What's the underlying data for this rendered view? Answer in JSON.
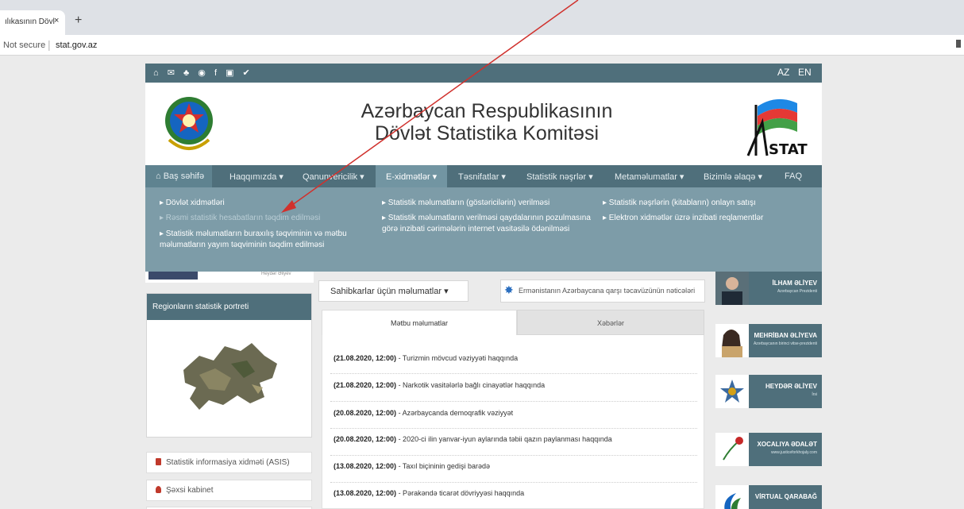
{
  "browser": {
    "tab_title": "ılıkasının Dövl",
    "tab_close": "×",
    "new_tab": "+",
    "security": "Not secure",
    "url": "stat.gov.az"
  },
  "topbar": {
    "social_icons": [
      "home-icon",
      "mail-icon",
      "sitemap-icon",
      "eye-icon",
      "facebook-icon",
      "youtube-icon",
      "twitter-icon"
    ],
    "social_glyphs": [
      "⌂",
      "✉",
      "♣",
      "◉",
      "f",
      "▣",
      "✔"
    ],
    "lang_az": "AZ",
    "lang_en": "EN"
  },
  "header": {
    "title_line1": "Azərbaycan Respublikasının",
    "title_line2": "Dövlət Statistika Komitəsi",
    "statlogo_text": "STAT"
  },
  "nav": {
    "items": [
      {
        "label": "⌂ Baş səhifə"
      },
      {
        "label": "Haqqımızda ▾"
      },
      {
        "label": "Qanunvericilik ▾"
      },
      {
        "label": "E-xidmətlər ▾"
      },
      {
        "label": "Təsnifatlar ▾"
      },
      {
        "label": "Statistik nəşrlər ▾"
      },
      {
        "label": "Metaməlumatlar ▾"
      },
      {
        "label": "Bizimlə əlaqə ▾"
      },
      {
        "label": "FAQ"
      }
    ]
  },
  "dropdown": {
    "col1": [
      "▸ Dövlət xidmətləri",
      "▸ Rəsmi statistik hesabatların təqdim edilməsi",
      "▸ Statistik məlumatların buraxılış təqviminin və mətbu məlumatların yayım təqviminin təqdim edilməsi"
    ],
    "col2": [
      "▸ Statistik məlumatların (göstəricilərin) verilməsi",
      "▸ Statistik məlumatların verilməsi qaydalarının pozulmasına görə inzibati cərimələrin internet vasitəsilə ödənilməsi"
    ],
    "col3": [
      "▸ Statistik nəşrlərin (kitabların) onlayn satışı",
      "▸ Elektron xidmətlər üzrə inzibati reqlamentlər"
    ]
  },
  "left": {
    "heydar_caption": "Heydər Əliyev",
    "region_title": "Regionların statistik portreti",
    "side_items": [
      "Statistik informasiya xidməti (ASIS)",
      "Şəxsi kabinet"
    ]
  },
  "center": {
    "entrepreneurs_dropdown": "Sahibkarlar üçün məlumatlar ▾",
    "war_button": "Ermənistanın Azərbaycana qarşı təcavüzünün nəticələri",
    "tab_press": "Mətbu məlumatlar",
    "tab_news": "Xəbərlər",
    "news": [
      {
        "date": "(21.08.2020, 12:00)",
        "text": " - Turizmin mövcud vəziyyəti haqqında"
      },
      {
        "date": "(21.08.2020, 12:00)",
        "text": " - Narkotik vasitələrlə bağlı cinayətlər haqqında"
      },
      {
        "date": "(20.08.2020, 12:00)",
        "text": " - Azərbaycanda demoqrafik vəziyyət"
      },
      {
        "date": "(20.08.2020, 12:00)",
        "text": " - 2020-ci ilin yanvar-iyun aylarında təbii qazın paylanması haqqında"
      },
      {
        "date": "(13.08.2020, 12:00)",
        "text": " - Taxıl biçininin gedişi barədə"
      },
      {
        "date": "(13.08.2020, 12:00)",
        "text": " - Pərakəndə ticarət dövriyyəsi haqqında"
      }
    ]
  },
  "right": {
    "banners": [
      {
        "title": "İLHAM ƏLİYEV",
        "sub": "Azərbaycan Prezidenti",
        "bg": "#4f6f7b"
      },
      {
        "title": "MEHRİBAN ƏLİYEVA",
        "sub": "Azərbaycanın birinci vitse-prezidenti",
        "bg": "#4f6f7b"
      },
      {
        "title": "HEYDƏR ƏLİYEV",
        "sub": "İrsi",
        "bg": "#4f6f7b"
      },
      {
        "title": "XOCALIYA ƏDALƏT",
        "sub": "www.justiceforkhojaly.com",
        "bg": "#4f6f7b"
      },
      {
        "title": "VİRTUAL QARABAĞ",
        "sub": "",
        "bg": "#4f6f7b"
      }
    ]
  },
  "colors": {
    "primary": "#4f6f7b",
    "dropdown": "#7898a4",
    "annotation_arrow": "#d0312d"
  }
}
